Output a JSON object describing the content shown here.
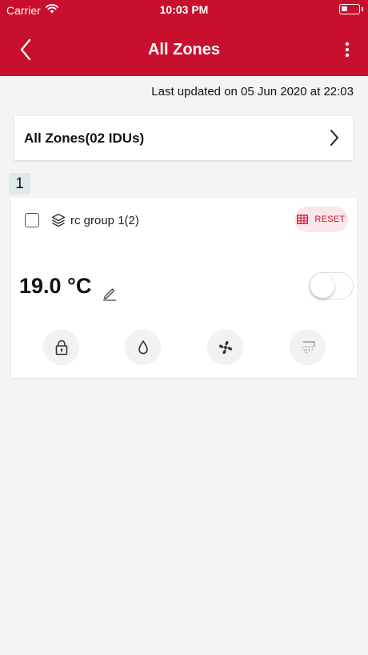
{
  "status_bar": {
    "carrier": "Carrier",
    "time": "10:03 PM"
  },
  "header": {
    "title": "All Zones",
    "back_icon": "chevron-left-icon",
    "more_icon": "more-vertical-icon",
    "background_color": "#c8102e"
  },
  "last_updated": "Last updated on 05 Jun 2020 at 22:03",
  "zones_card": {
    "label": "All Zones(02 IDUs)",
    "icon": "chevron-right-icon"
  },
  "group": {
    "number": "1",
    "name": "rc group 1(2)",
    "checked": false,
    "reset_label": "RESET",
    "temperature": "19.0 °C",
    "power_on": false,
    "mode_buttons": [
      "lock-icon",
      "water-drop-icon",
      "fan-icon",
      "swing-icon"
    ]
  },
  "colors": {
    "accent": "#c8102e",
    "reset_bg": "#fbe6e9",
    "group_number_bg": "#dfe9ea",
    "page_bg": "#f4f4f4"
  }
}
